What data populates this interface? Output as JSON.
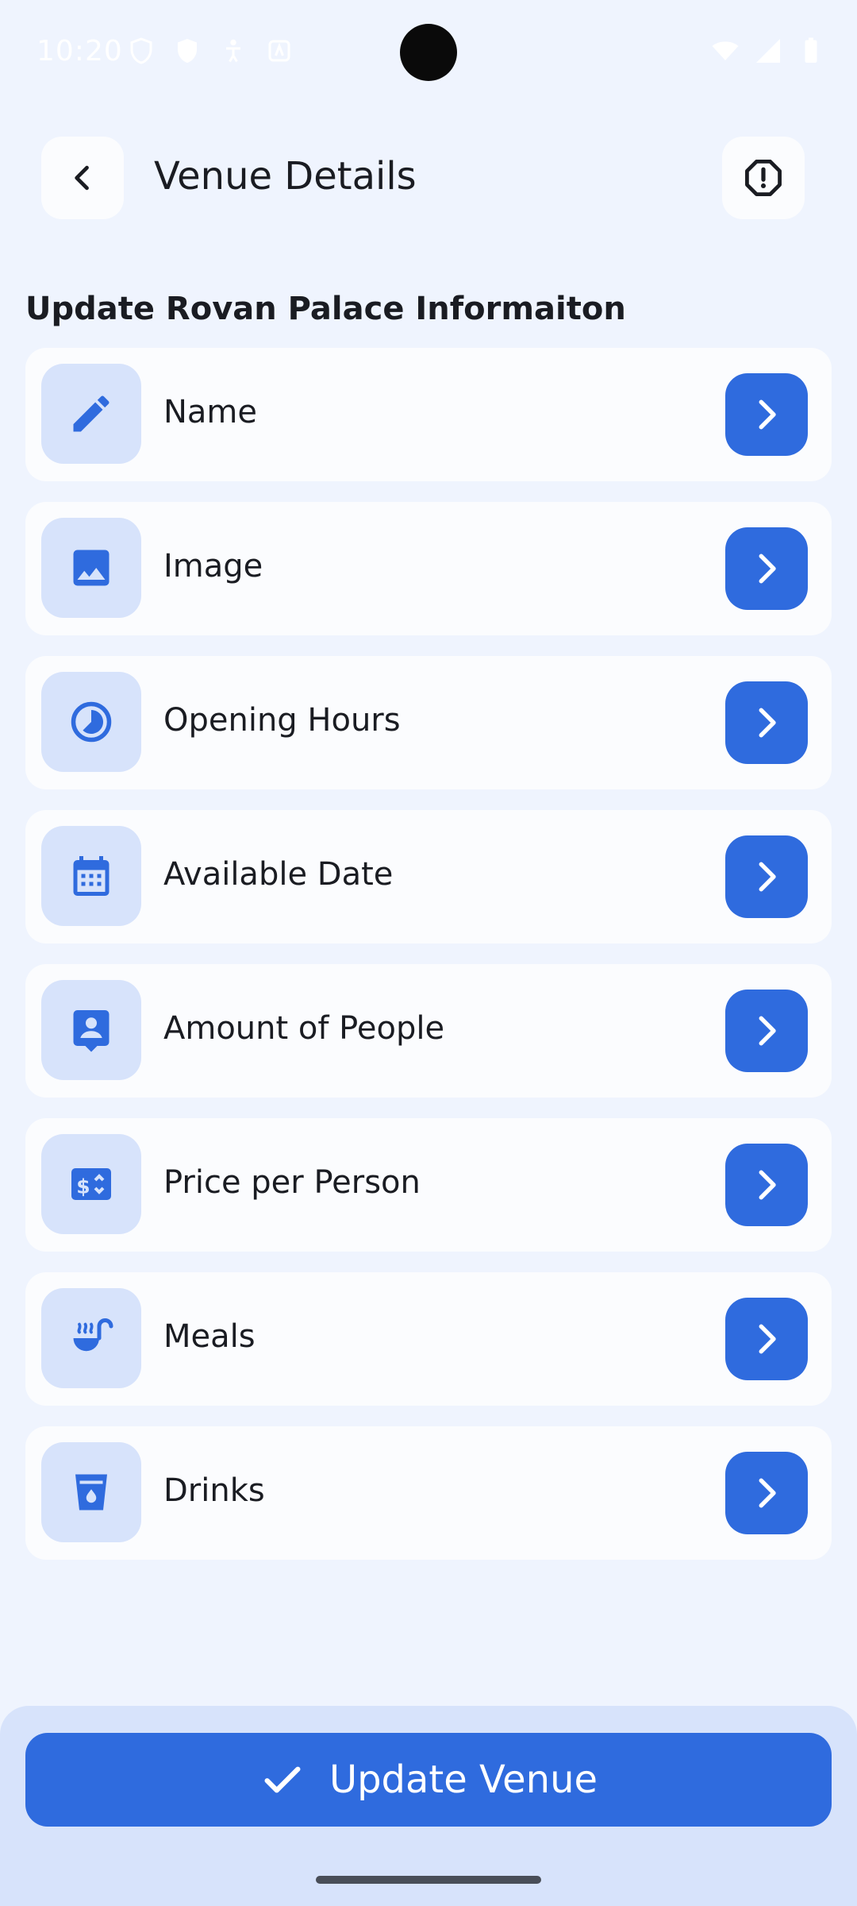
{
  "status_bar": {
    "time": "10:20"
  },
  "header": {
    "title": "Venue Details"
  },
  "section": {
    "heading": "Update Rovan Palace Informaiton"
  },
  "items": [
    {
      "label": "Name",
      "icon": "pencil-icon"
    },
    {
      "label": "Image",
      "icon": "image-icon"
    },
    {
      "label": "Opening Hours",
      "icon": "clock-icon"
    },
    {
      "label": "Available Date",
      "icon": "calendar-icon"
    },
    {
      "label": "Amount of People",
      "icon": "person-badge-icon"
    },
    {
      "label": "Price per Person",
      "icon": "price-tag-icon"
    },
    {
      "label": "Meals",
      "icon": "soup-bowl-icon"
    },
    {
      "label": "Drinks",
      "icon": "cup-icon"
    }
  ],
  "footer": {
    "update_label": "Update Venue"
  },
  "colors": {
    "background": "#eff4fe",
    "accent": "#2f6bde",
    "icon_tile": "#d7e3fb",
    "card": "#fbfcfe"
  }
}
